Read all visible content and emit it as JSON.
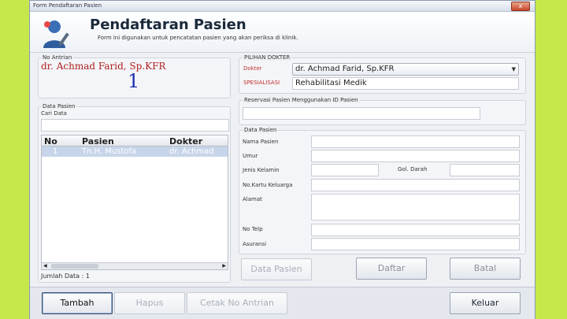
{
  "window": {
    "title": "Form Pendaftaran Pasien",
    "close_label": "x"
  },
  "header": {
    "title": "Pendaftaran Pasien",
    "subtitle": "Form ini digunakan untuk pencatatan pasien yang akan periksa di klinik."
  },
  "queue": {
    "label": "No Antrian",
    "doctor": "dr. Achmad Farid, Sp.KFR",
    "number": "1"
  },
  "patient_list": {
    "label": "Data Pasien",
    "search_label": "Cari Data",
    "search_value": "",
    "columns": [
      "No",
      "Pasien",
      "Dokter"
    ],
    "rows": [
      {
        "no": "1",
        "pasien": "Tn.H. Mustofa",
        "dokter": "dr. Achmad"
      }
    ],
    "count_text": "Jumlah Data : 1"
  },
  "doctor_select": {
    "label": "PILIHAN DOKTER",
    "doctor_label": "Dokter",
    "doctor_value": "dr. Achmad Farid, Sp.KFR",
    "specialty_label": "SPESIALISASI",
    "specialty_value": "Rehabilitasi Medik"
  },
  "reservation": {
    "label": "Reservasi Pasien Menggunakan ID Pasien",
    "value": ""
  },
  "patient_form": {
    "label": "Data Pasien",
    "fields": {
      "name": "Nama Pasien",
      "age": "Umur",
      "gender": "Jenis Kelamin",
      "blood": "Gol. Darah",
      "family": "No.Kartu Keluarga",
      "address": "Alamat",
      "phone": "No Telp",
      "insurance": "Asuransi"
    }
  },
  "buttons": {
    "data_pasien": "Data Pasien",
    "daftar": "Daftar",
    "batal": "Batal",
    "tambah": "Tambah",
    "hapus": "Hapus",
    "cetak": "Cetak No Antrian",
    "keluar": "Keluar"
  },
  "colors": {
    "accent_red": "#c03030",
    "accent_blue": "#1a2fb0",
    "background": "#c6e84a"
  }
}
